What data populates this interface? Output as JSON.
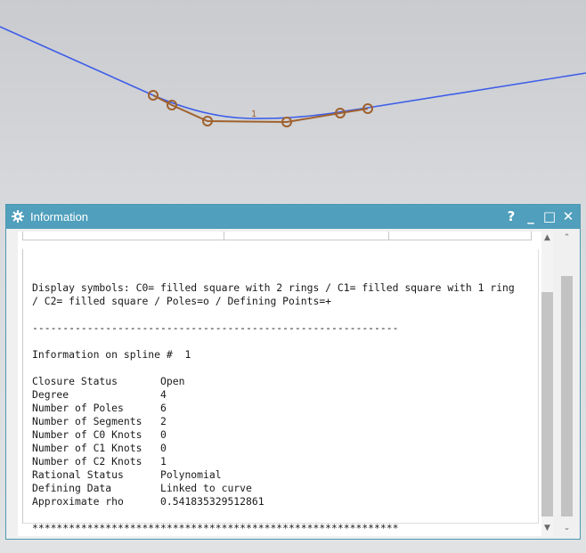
{
  "viewport": {
    "colors": {
      "curve": "#3d5de8",
      "spline": "#a0612e",
      "pole": "#a0612e"
    },
    "spline_label": "1"
  },
  "window": {
    "title": "Information",
    "icon": "gear-icon",
    "buttons": {
      "help": "?",
      "minimize": "_",
      "maximize": "□",
      "close": "✕"
    }
  },
  "info": {
    "lines": [
      "Display symbols: C0= filled square with 2 rings / C1= filled square with 1 ring",
      "/ C2= filled square / Poles=o / Defining Points=+",
      "",
      "------------------------------------------------------------",
      "",
      "Information on spline #  1",
      "",
      "Closure Status       Open",
      "Degree               4",
      "Number of Poles      6",
      "Number of Segments   2",
      "Number of C0 Knots   0",
      "Number of C1 Knots   0",
      "Number of C2 Knots   1",
      "Rational Status      Polynomial",
      "Defining Data        Linked to curve",
      "Approximate rho      0.541835329512861",
      "",
      "************************************************************"
    ]
  }
}
